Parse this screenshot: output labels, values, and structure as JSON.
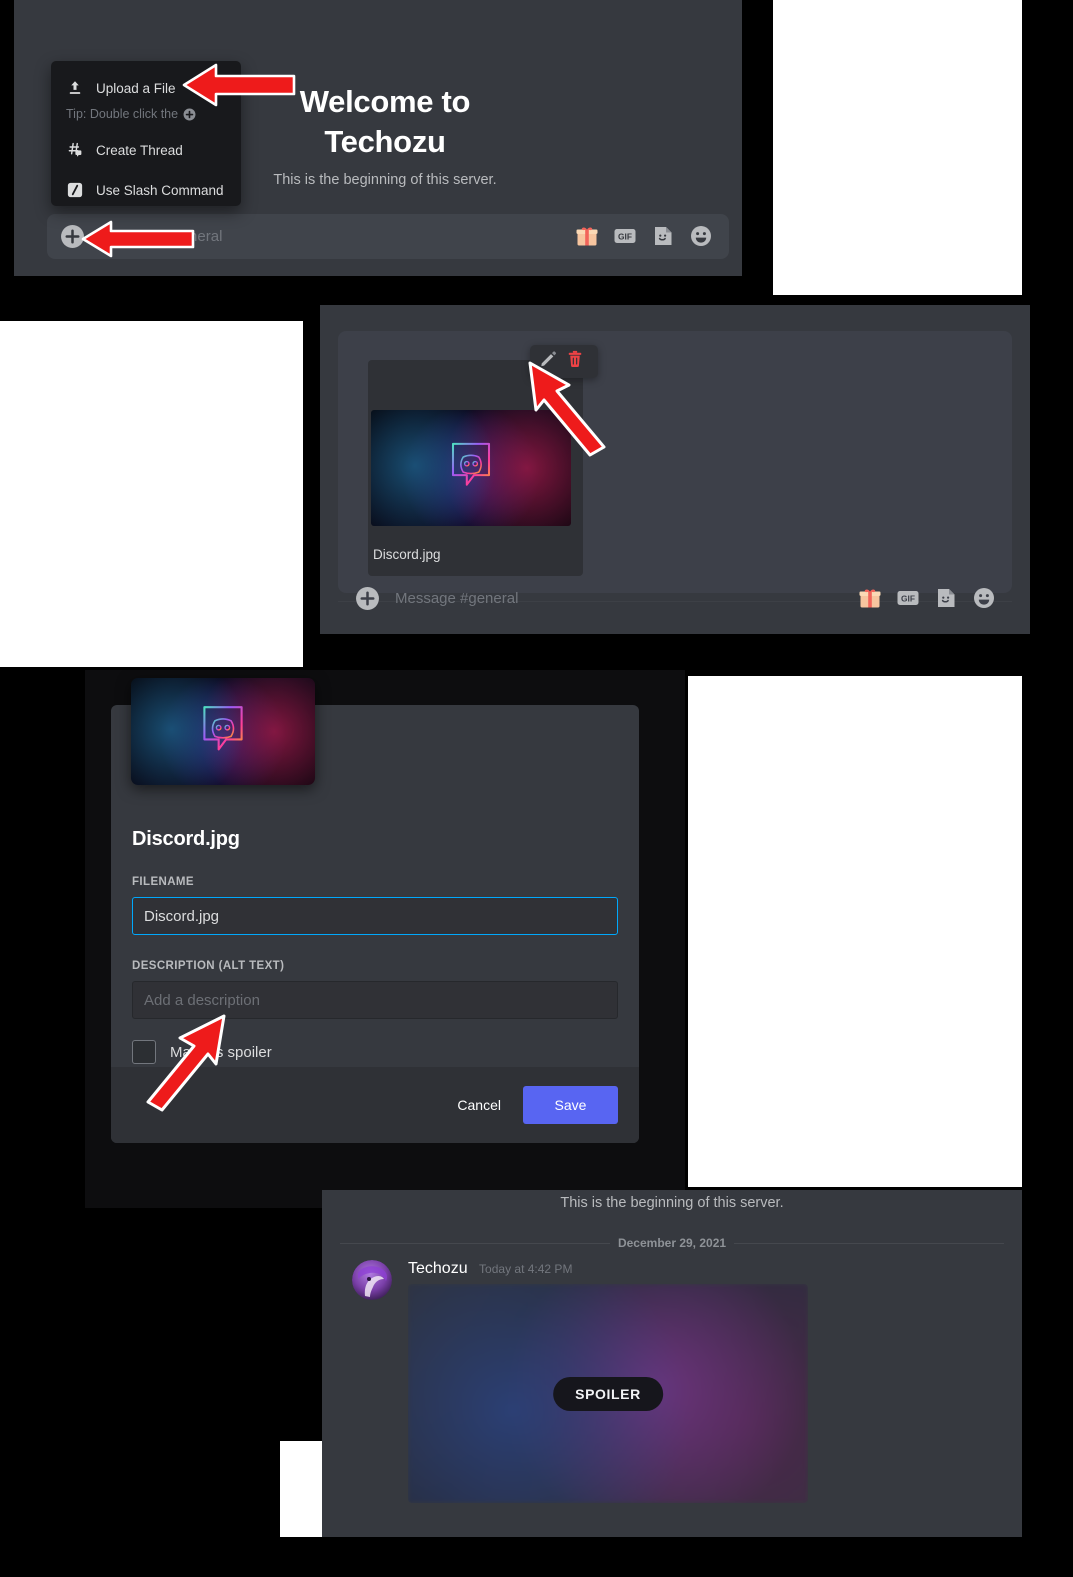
{
  "meta": {
    "app": "Discord",
    "flow": "Upload a file and mark it as a spoiler"
  },
  "panel1": {
    "name": "channel-empty-state-with-attach-menu",
    "welcome_title": "Welcome to\nTechozu",
    "welcome_line1": "Welcome to",
    "welcome_line2": "Techozu",
    "subtitle": "This is the beginning of this server.",
    "composer_placeholder": "Message #general",
    "menu": {
      "items": [
        {
          "label": "Upload a File",
          "icon": "upload-icon"
        },
        {
          "label": "Create Thread",
          "icon": "thread-icon"
        },
        {
          "label": "Use Slash Command",
          "icon": "slash-command-icon"
        }
      ],
      "tip": "Tip: Double click the",
      "tip_icon": "plus-circle-icon"
    },
    "composer_icons": [
      "gift-icon",
      "gif-icon",
      "sticker-icon",
      "emoji-icon"
    ],
    "attach_icon": "plus-circle-icon"
  },
  "panel2": {
    "name": "upload-preview-with-edit-actions",
    "filename": "Discord.jpg",
    "composer_placeholder": "Message #general",
    "actions": [
      {
        "label": "Edit file",
        "icon": "pencil-icon"
      },
      {
        "label": "Remove file",
        "icon": "trash-icon"
      }
    ],
    "composer_icons": [
      "gift-icon",
      "gif-icon",
      "sticker-icon",
      "emoji-icon"
    ],
    "attach_icon": "plus-circle-icon"
  },
  "panel3": {
    "name": "edit-attachment-modal",
    "title": "Discord.jpg",
    "filename_label": "FILENAME",
    "filename_value": "Discord.jpg",
    "description_label": "DESCRIPTION (ALT TEXT)",
    "description_placeholder": "Add a description",
    "description_value": "",
    "spoiler_label": "Mark as spoiler",
    "spoiler_checked": false,
    "cancel_label": "Cancel",
    "save_label": "Save",
    "save_color": "#5865f2",
    "focus_border_color": "#00a8fc"
  },
  "panel4": {
    "name": "sent-message-with-spoiler-image",
    "beginning_text": "This is the beginning of this server.",
    "date_divider": "December 29, 2021",
    "author": "Techozu",
    "timestamp": "Today at 4:42 PM",
    "spoiler_badge": "SPOILER"
  },
  "annotations": {
    "arrow_color": "#ee1b1b",
    "arrows": [
      {
        "target": "Upload a File menu item"
      },
      {
        "target": "Attach (plus) button"
      },
      {
        "target": "Pencil / edit file button"
      },
      {
        "target": "Mark as spoiler checkbox"
      }
    ]
  }
}
